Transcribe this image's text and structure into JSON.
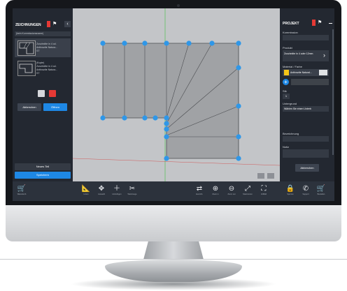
{
  "left_panel": {
    "title": "ZEICHNUNGEN",
    "search_placeholder": "(kein Kommissionsname)",
    "items": [
      {
        "line1": "Zuschnitte in 4 od.",
        "line2": "Anthrazite Natura...",
        "line3": "ST"
      },
      {
        "line1": "(Kopie)",
        "line2": "Zuschnitte in 4 od.",
        "line3": "Anthrazite Natura...",
        "line4": "ST"
      }
    ],
    "cancel_label": "Abbrechen",
    "open_label": "Öffnen",
    "new_part_label": "Neues Teil",
    "save_label": "Speichern"
  },
  "right_panel": {
    "title": "PROJEKT",
    "commission_label": "Kommission",
    "product_label": "Produkt",
    "product_value": "Zuschnitte in 4 oder 12mm",
    "material_label": "Material / Farbe",
    "material_value": "Anthrazite Natural...",
    "qty_label": "Stk",
    "qty_value": "1",
    "subgrade_label": "Untergrund",
    "subgrade_value": "Wählen Sie einen Unterb",
    "name_label": "Bezeichnung",
    "notes_label": "Notiz",
    "cancel_label": "Abbrechen"
  },
  "toolbar": {
    "left_items": [
      {
        "icon": "cart-icon",
        "glyph": "🛒",
        "label": "Warenkorb"
      }
    ],
    "mid_items": [
      {
        "icon": "ruler-icon",
        "glyph": "📐",
        "label": "Linien"
      },
      {
        "icon": "select-icon",
        "glyph": "✥",
        "label": "Auswahl"
      },
      {
        "icon": "add-icon",
        "glyph": "＋",
        "label": "Hinzufügen"
      },
      {
        "icon": "tools-icon",
        "glyph": "✂",
        "label": "Werkzeuge"
      }
    ],
    "view_items": [
      {
        "icon": "align-icon",
        "glyph": "⇄",
        "label": "Ausricht."
      },
      {
        "icon": "zoom-in-icon",
        "glyph": "⊕",
        "label": "Zoom in"
      },
      {
        "icon": "zoom-out-icon",
        "glyph": "⊖",
        "label": "Zoom out"
      },
      {
        "icon": "fit-icon",
        "glyph": "⤢",
        "label": "Maximieren"
      },
      {
        "icon": "fullscreen-icon",
        "glyph": "⛶",
        "label": "Vollbild"
      }
    ],
    "right_items": [
      {
        "icon": "lock-icon",
        "glyph": "🔒",
        "label": "Sperren"
      },
      {
        "icon": "phone-icon",
        "glyph": "✆",
        "label": "Support"
      },
      {
        "icon": "cart-full-icon",
        "glyph": "🛒",
        "label": "Bestellen"
      }
    ]
  },
  "colors": {
    "accent": "#1e88e5",
    "panel": "#232831",
    "handle": "#2f97e8",
    "shape_fill": "#a0a2a5",
    "danger": "#e53935"
  }
}
